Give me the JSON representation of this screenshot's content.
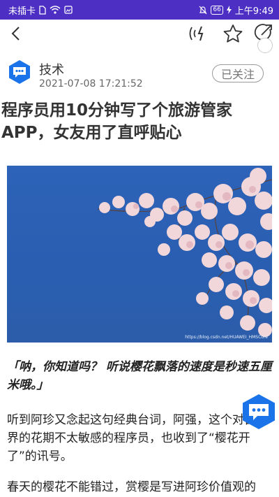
{
  "status_bar": {
    "carrier": "未插卡",
    "battery": "66",
    "time_text": "上午9:49"
  },
  "author": {
    "name": "技术",
    "datetime": "2021-07-08 17:21:52",
    "follow_label": "已关注"
  },
  "article": {
    "title": "程序员用10分钟写了个旅游管家APP，女友用了直呼贴心",
    "image_caption": "https://blog.csdn.net/HUAWEI_HMSCore",
    "quote": "「呐，你知道吗？ 听说樱花飘落的速度是秒速五厘米哦。」",
    "paragraphs": [
      "听到阿珍又念起这句经典台词，阿强，这个对自然界的花期不太敏感的程序员，也收到了“樱花开了”的讯号。",
      "春天的樱花不能错过，赏樱是写进阿珍价值观的"
    ]
  },
  "icons": {
    "back": "back-arrow-icon",
    "voice": "voice-broadcast-icon",
    "favorite": "star-icon",
    "share": "share-icon",
    "author_avatar": "chat-bubble-hexagon-icon",
    "comment_fab": "chat-bubble-hexagon-icon"
  },
  "colors": {
    "status_bar": "#4d2fc4",
    "accent_blue": "#1a73e8",
    "sky": "#2d63b8"
  }
}
